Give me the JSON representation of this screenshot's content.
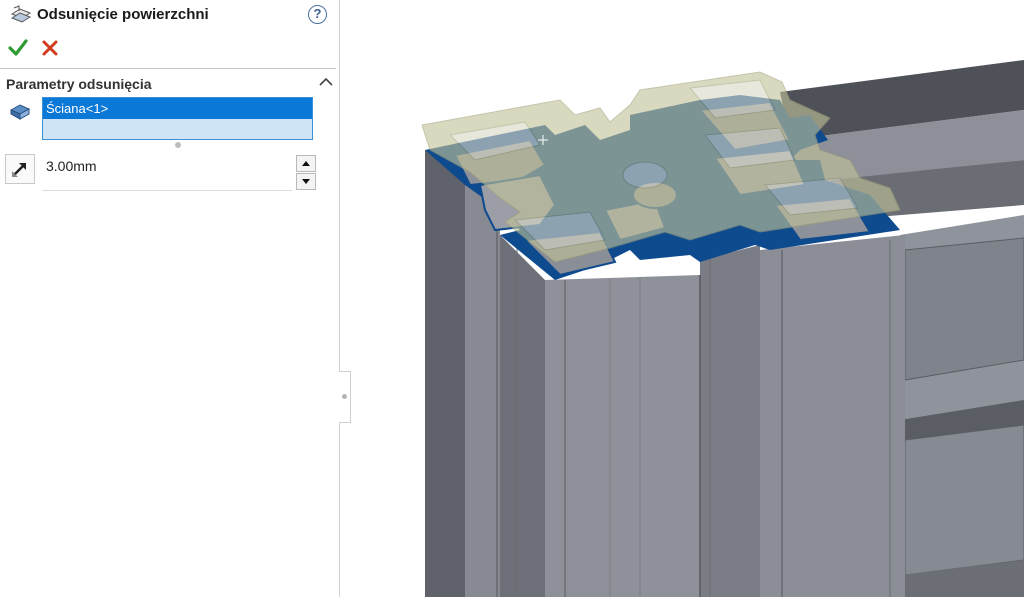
{
  "feature": {
    "title": "Odsunięcie powierzchni",
    "help_icon": "help-icon",
    "help_label": "?",
    "ok_icon": "checkmark-icon",
    "cancel_icon": "cross-icon"
  },
  "parameters": {
    "section_title": "Parametry odsunięcia",
    "selection_items": [
      "Ściana<1>"
    ],
    "distance_value": "3.00mm",
    "distance_icon": "offset-direction-icon",
    "face_icon": "face-selection-icon"
  },
  "colors": {
    "selection_highlight": "#0a78d7",
    "selection_box": "#cfe4f7",
    "selected_face": "#0e4a8e",
    "offset_preview": "#c8c8a2",
    "ok_green": "#2e9b31",
    "cancel_red": "#d23a1e"
  }
}
